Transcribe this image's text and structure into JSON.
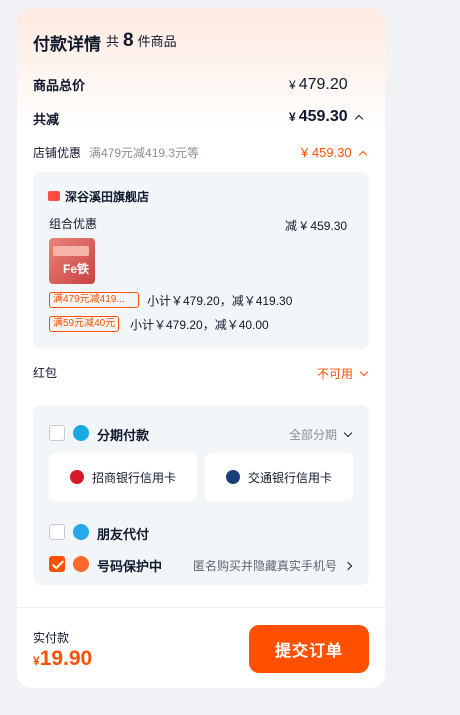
{
  "header": {
    "title": "付款详情",
    "count_prefix": "共",
    "count_value": "8",
    "count_suffix": "件商品"
  },
  "summary": {
    "total_label": "商品总价",
    "total_currency": "¥",
    "total_value": "479.20",
    "discount_label": "共减",
    "discount_currency": "¥",
    "discount_value": "459.30"
  },
  "shop_discount": {
    "label": "店铺优惠",
    "rule": "满479元减419.3元等",
    "currency": "¥",
    "value": "459.30"
  },
  "store": {
    "name": "深谷溪田旗舰店",
    "combo_label": "组合优惠",
    "combo_prefix": "减",
    "combo_currency": "¥",
    "combo_value": "459.30",
    "product_badge": "Fe铁",
    "promos": [
      {
        "tag": "满479元减419...",
        "subtotal": "小计￥479.20，减￥419.30"
      },
      {
        "tag": "满59元减40元",
        "subtotal": "小计￥479.20，减￥40.00"
      }
    ]
  },
  "red_packet": {
    "label": "红包",
    "status": "不可用"
  },
  "payment_options": {
    "installment": {
      "label": "分期付款",
      "action": "全部分期",
      "checked": false
    },
    "banks": [
      {
        "name": "招商银行信用卡"
      },
      {
        "name": "交通银行信用卡"
      }
    ],
    "friend_pay": {
      "label": "朋友代付",
      "checked": false
    },
    "number_protect": {
      "label": "号码保护中",
      "desc": "匿名购买并隐藏真实手机号",
      "checked": true
    }
  },
  "footer": {
    "paid_label": "实付款",
    "paid_currency": "¥",
    "paid_value": "19.90",
    "submit_label": "提交订单"
  },
  "colors": {
    "accent": "#ff5000",
    "text": "#11192d",
    "muted": "#8a8f99",
    "box_bg": "#f3f6f8",
    "page_bg": "#f1f2f5"
  }
}
